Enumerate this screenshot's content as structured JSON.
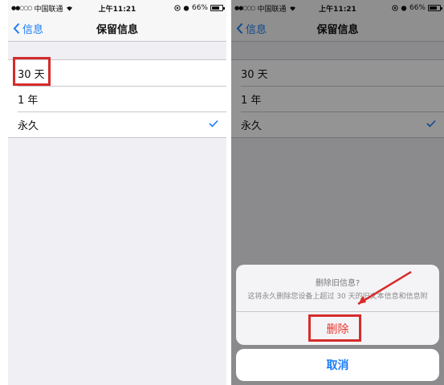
{
  "status_bar": {
    "signal": "●●○○○",
    "carrier": "中国联通",
    "time": "上午11:21",
    "battery": "66%"
  },
  "nav": {
    "back_label": "信息",
    "title": "保留信息"
  },
  "options": [
    {
      "label": "30 天",
      "selected": false
    },
    {
      "label": "1 年",
      "selected": false
    },
    {
      "label": "永久",
      "selected": true
    }
  ],
  "action_sheet": {
    "title": "删除旧信息?",
    "message": "这将永久删除您设备上超过 30 天的旧文本信息和信息附",
    "delete_label": "删除",
    "cancel_label": "取消"
  },
  "colors": {
    "accent": "#1a7cf6",
    "destructive": "#e8372f",
    "highlight": "#d62b2b"
  }
}
